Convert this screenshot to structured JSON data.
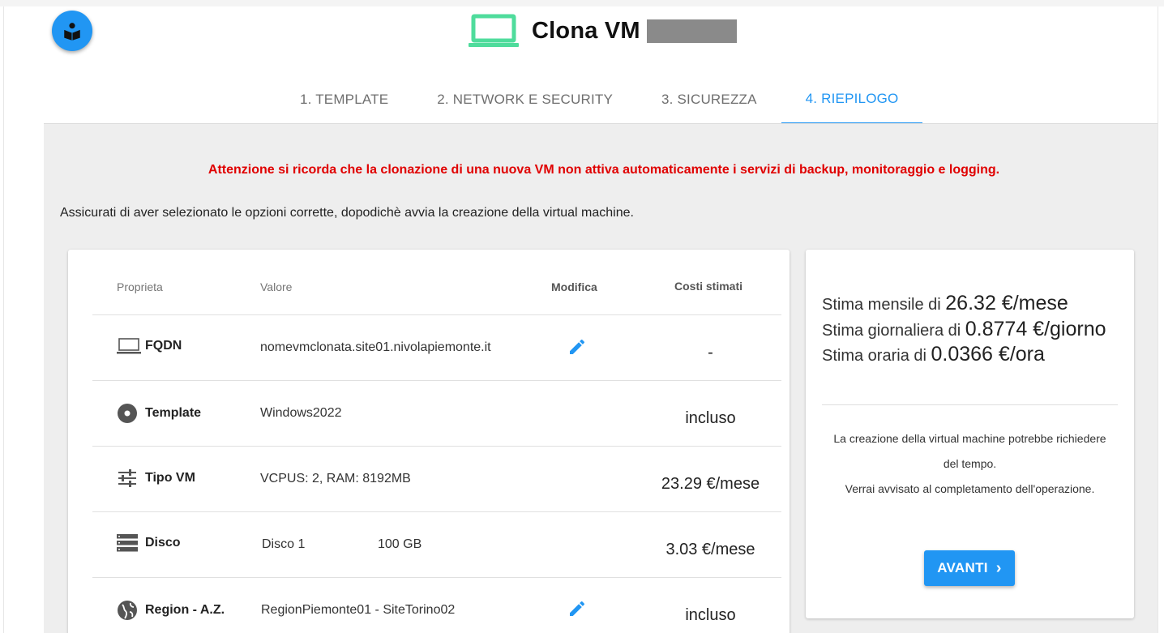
{
  "header": {
    "title": "Clona VM",
    "fab_icon": "book-reader-icon",
    "title_icon": "laptop-icon",
    "title_icon_color": "#4fdc9c"
  },
  "tabs": [
    {
      "label": "1. TEMPLATE",
      "active": false
    },
    {
      "label": "2. NETWORK E SECURITY",
      "active": false
    },
    {
      "label": "3. SICUREZZA",
      "active": false
    },
    {
      "label": "4. RIEPILOGO",
      "active": true
    }
  ],
  "warning": "Attenzione si ricorda che la clonazione di una nuova VM non attiva automaticamente i servizi di backup, monitoraggio e logging.",
  "instruction": "Assicurati di aver selezionato le opzioni corrette, dopodichè avvia la creazione della virtual machine.",
  "table": {
    "headers": {
      "property": "Proprieta",
      "value": "Valore",
      "edit": "Modifica",
      "cost": "Costi stimati"
    },
    "rows": [
      {
        "icon": "laptop-icon",
        "label": "FQDN",
        "value": "nomevmclonata.site01.nivolapiemonte.it",
        "value2": "",
        "editable": true,
        "cost": "-"
      },
      {
        "icon": "disc-icon",
        "label": "Template",
        "value": "Windows2022",
        "value2": "",
        "editable": false,
        "cost": "incluso"
      },
      {
        "icon": "tune-icon",
        "label": "Tipo VM",
        "value": "VCPUS: 2, RAM: 8192MB",
        "value2": "",
        "editable": false,
        "cost": "23.29 €/mese"
      },
      {
        "icon": "storage-icon",
        "label": "Disco",
        "value": "Disco 1",
        "value2": "100 GB",
        "editable": false,
        "cost": "3.03 €/mese"
      },
      {
        "icon": "globe-icon",
        "label": "Region - A.Z.",
        "value": "RegionPiemonte01 - SiteTorino02",
        "value2": "",
        "editable": true,
        "cost": "incluso"
      }
    ]
  },
  "estimates": {
    "monthly_label": "Stima mensile di",
    "monthly_value": "26.32 €/mese",
    "daily_label": "Stima giornaliera di",
    "daily_value": "0.8774 €/giorno",
    "hourly_label": "Stima oraria di",
    "hourly_value": "0.0366 €/ora"
  },
  "notes": {
    "line1": "La creazione della virtual machine potrebbe richiedere",
    "line2": "del tempo.",
    "line3": "Verrai avvisato al completamento dell'operazione."
  },
  "next_button": "AVANTI",
  "colors": {
    "accent": "#2196f3",
    "warning": "#e00000",
    "content_bg": "#eeeeee"
  }
}
